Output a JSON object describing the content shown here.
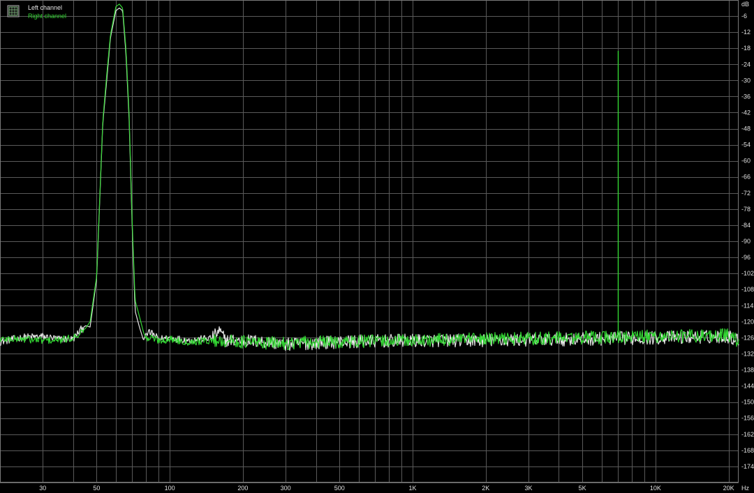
{
  "chart_data": {
    "type": "line",
    "title": "",
    "x_scale": "log",
    "xlim": [
      20,
      22000
    ],
    "ylim": [
      -180,
      0
    ],
    "x_unit_label": "Hz",
    "y_unit_label": "dB",
    "x_tick_labels": [
      {
        "value": 30,
        "label": "30"
      },
      {
        "value": 50,
        "label": "50"
      },
      {
        "value": 100,
        "label": "100"
      },
      {
        "value": 200,
        "label": "200"
      },
      {
        "value": 300,
        "label": "300"
      },
      {
        "value": 500,
        "label": "500"
      },
      {
        "value": 1000,
        "label": "1K"
      },
      {
        "value": 2000,
        "label": "2K"
      },
      {
        "value": 3000,
        "label": "3K"
      },
      {
        "value": 5000,
        "label": "5K"
      },
      {
        "value": 10000,
        "label": "10K"
      },
      {
        "value": 20000,
        "label": "20K"
      }
    ],
    "y_ticks": [
      -6,
      -12,
      -18,
      -24,
      -30,
      -36,
      -42,
      -48,
      -54,
      -60,
      -66,
      -72,
      -78,
      -84,
      -90,
      -96,
      -102,
      -108,
      -114,
      -120,
      -126,
      -132,
      -138,
      -144,
      -150,
      -156,
      -162,
      -168,
      -174
    ],
    "grid": true,
    "legend_position": "top-left",
    "background_color": "#000000",
    "grid_color": "#5a5a5a",
    "series": [
      {
        "name": "Left channel",
        "color": "#e6e6e6",
        "points": [
          [
            20,
            -127.5
          ],
          [
            25,
            -125.8
          ],
          [
            30,
            -125.5
          ],
          [
            35,
            -126.5
          ],
          [
            40,
            -126.5
          ],
          [
            43,
            -123
          ],
          [
            45,
            -121.5
          ],
          [
            47,
            -122
          ],
          [
            50,
            -104
          ],
          [
            53,
            -46
          ],
          [
            55,
            -30
          ],
          [
            57,
            -14
          ],
          [
            60,
            -4
          ],
          [
            62,
            -3
          ],
          [
            64,
            -4
          ],
          [
            66,
            -20
          ],
          [
            68,
            -44
          ],
          [
            70,
            -84
          ],
          [
            72,
            -116
          ],
          [
            75,
            -122
          ],
          [
            78,
            -127
          ],
          [
            80,
            -124
          ],
          [
            85,
            -124.5
          ],
          [
            90,
            -126.5
          ],
          [
            100,
            -126
          ],
          [
            120,
            -127
          ],
          [
            150,
            -126
          ],
          [
            160,
            -123.5
          ],
          [
            170,
            -127
          ],
          [
            200,
            -127
          ],
          [
            250,
            -127.5
          ],
          [
            300,
            -128.5
          ],
          [
            500,
            -127.5
          ],
          [
            1000,
            -127
          ],
          [
            2000,
            -127
          ],
          [
            5000,
            -126.5
          ],
          [
            10000,
            -126
          ],
          [
            20000,
            -125.5
          ],
          [
            22000,
            -127
          ]
        ],
        "noise_band": 2.5
      },
      {
        "name": "Right channel",
        "color": "#33d633",
        "points": [
          [
            20,
            -126.5
          ],
          [
            25,
            -126.5
          ],
          [
            30,
            -127
          ],
          [
            35,
            -127
          ],
          [
            40,
            -126
          ],
          [
            43,
            -124
          ],
          [
            45,
            -122.5
          ],
          [
            47,
            -120
          ],
          [
            50,
            -103
          ],
          [
            53,
            -45
          ],
          [
            55,
            -28
          ],
          [
            57,
            -13
          ],
          [
            60,
            -2.5
          ],
          [
            62,
            -1.5
          ],
          [
            64,
            -3
          ],
          [
            66,
            -18
          ],
          [
            68,
            -42
          ],
          [
            70,
            -82
          ],
          [
            72,
            -112
          ],
          [
            75,
            -118
          ],
          [
            78,
            -124
          ],
          [
            80,
            -126.5
          ],
          [
            85,
            -126
          ],
          [
            90,
            -127
          ],
          [
            100,
            -126.5
          ],
          [
            120,
            -127.5
          ],
          [
            150,
            -127
          ],
          [
            200,
            -127.5
          ],
          [
            250,
            -128
          ],
          [
            300,
            -128
          ],
          [
            500,
            -127.5
          ],
          [
            1000,
            -127
          ],
          [
            2000,
            -126.5
          ],
          [
            5000,
            -126
          ],
          [
            7000,
            -19
          ],
          [
            10000,
            -125.5
          ],
          [
            20000,
            -125
          ],
          [
            22000,
            -127.5
          ]
        ],
        "noise_band": 2.5,
        "spikes": [
          {
            "x": 7000,
            "y": -19
          }
        ]
      }
    ]
  },
  "legend": {
    "icon": "grid-icon",
    "items": [
      {
        "label": "Left channel",
        "color": "#e6e6e6"
      },
      {
        "label": "Right channel",
        "color": "#33d633"
      }
    ]
  }
}
